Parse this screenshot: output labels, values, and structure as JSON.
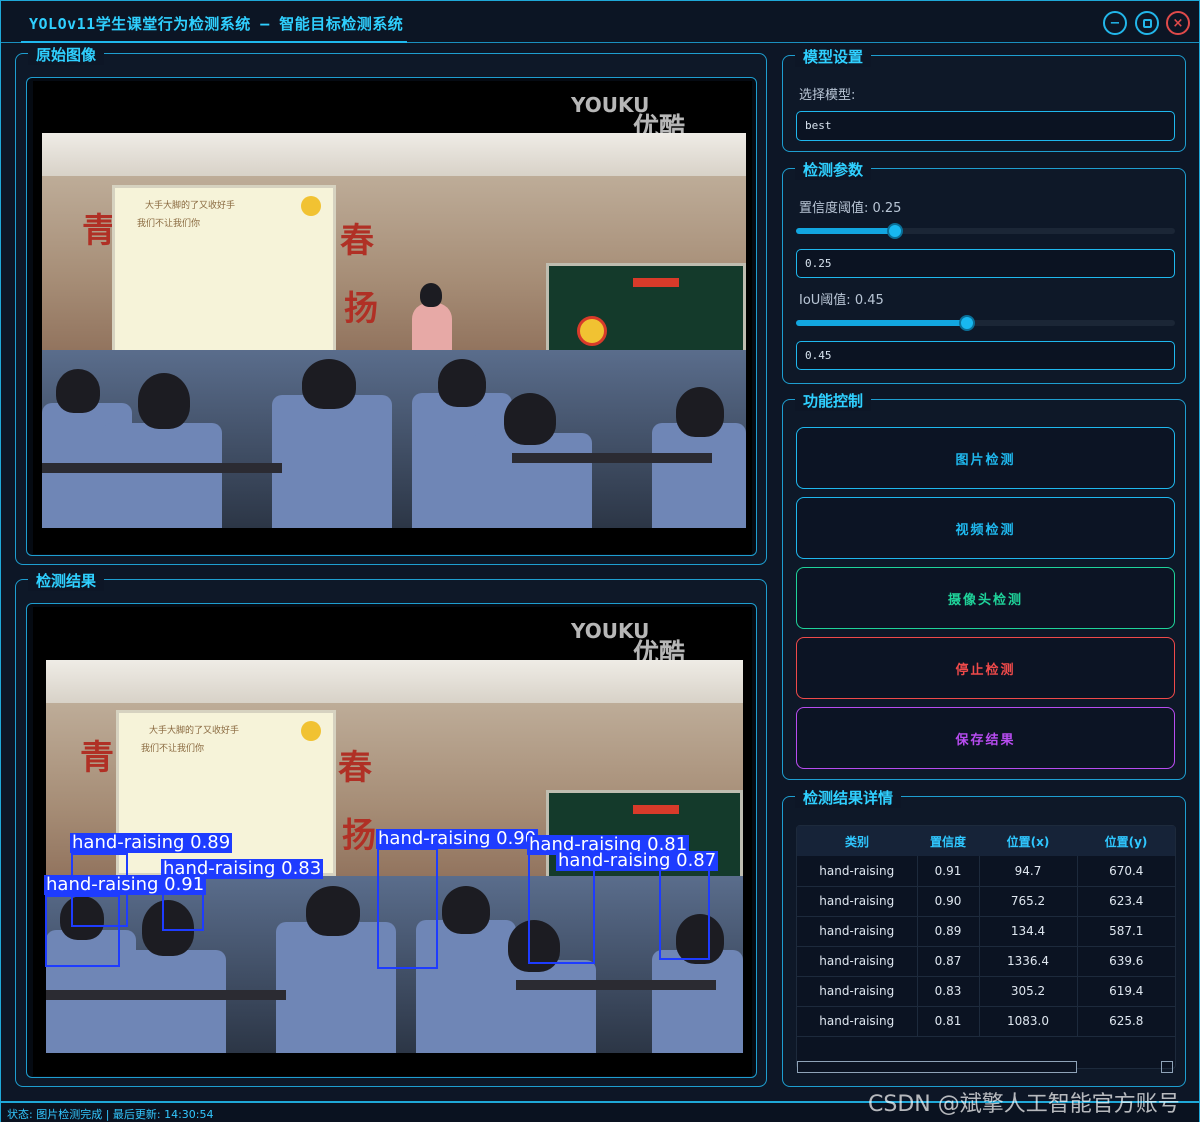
{
  "window": {
    "title": "YOLOv11学生课堂行为检测系统 – 智能目标检测系统",
    "controls": {
      "minimize": "−",
      "maximize": "▢",
      "close": "×"
    }
  },
  "panels": {
    "original": {
      "title": "原始图像"
    },
    "result": {
      "title": "检测结果"
    }
  },
  "image": {
    "watermark_latin": "YOUKU",
    "watermark_cjk": "优酷",
    "screen_text_line1": "大手大脚的了又收好手",
    "screen_text_line2": "我们不让我们你"
  },
  "detections": [
    {
      "label": "hand-raising 0.89"
    },
    {
      "label": "hand-raising 0.83"
    },
    {
      "label": "hand-raising 0.91"
    },
    {
      "label": "hand-raising 0.90"
    },
    {
      "label": "hand-raising 0.81"
    },
    {
      "label": "hand-raising 0.87"
    }
  ],
  "model_settings": {
    "title": "模型设置",
    "select_label": "选择模型:",
    "selected_model": "best"
  },
  "detect_params": {
    "title": "检测参数",
    "confidence_label": "置信度阈值: 0.25",
    "confidence_value": "0.25",
    "confidence_level": 0.25,
    "iou_label": "IoU阈值: 0.45",
    "iou_value": "0.45",
    "iou_level": 0.45
  },
  "function_control": {
    "title": "功能控制",
    "buttons": [
      {
        "label": "图片检测",
        "color": "#1fb8ee"
      },
      {
        "label": "视频检测",
        "color": "#1fb8ee"
      },
      {
        "label": "摄像头检测",
        "color": "#1fd39a"
      },
      {
        "label": "停止检测",
        "color": "#ef4a4a"
      },
      {
        "label": "保存结果",
        "color": "#b84cf0"
      }
    ]
  },
  "result_details": {
    "title": "检测结果详情",
    "columns": [
      "类别",
      "置信度",
      "位置(x)",
      "位置(y)"
    ],
    "rows": [
      [
        "hand-raising",
        "0.91",
        "94.7",
        "670.4"
      ],
      [
        "hand-raising",
        "0.90",
        "765.2",
        "623.4"
      ],
      [
        "hand-raising",
        "0.89",
        "134.4",
        "587.1"
      ],
      [
        "hand-raising",
        "0.87",
        "1336.4",
        "639.6"
      ],
      [
        "hand-raising",
        "0.83",
        "305.2",
        "619.4"
      ],
      [
        "hand-raising",
        "0.81",
        "1083.0",
        "625.8"
      ]
    ]
  },
  "status": {
    "text": "状态: 图片检测完成 | 最后更新: 14:30:54"
  },
  "overlay": {
    "csdn_watermark": "CSDN @斌擎人工智能官方账号"
  }
}
